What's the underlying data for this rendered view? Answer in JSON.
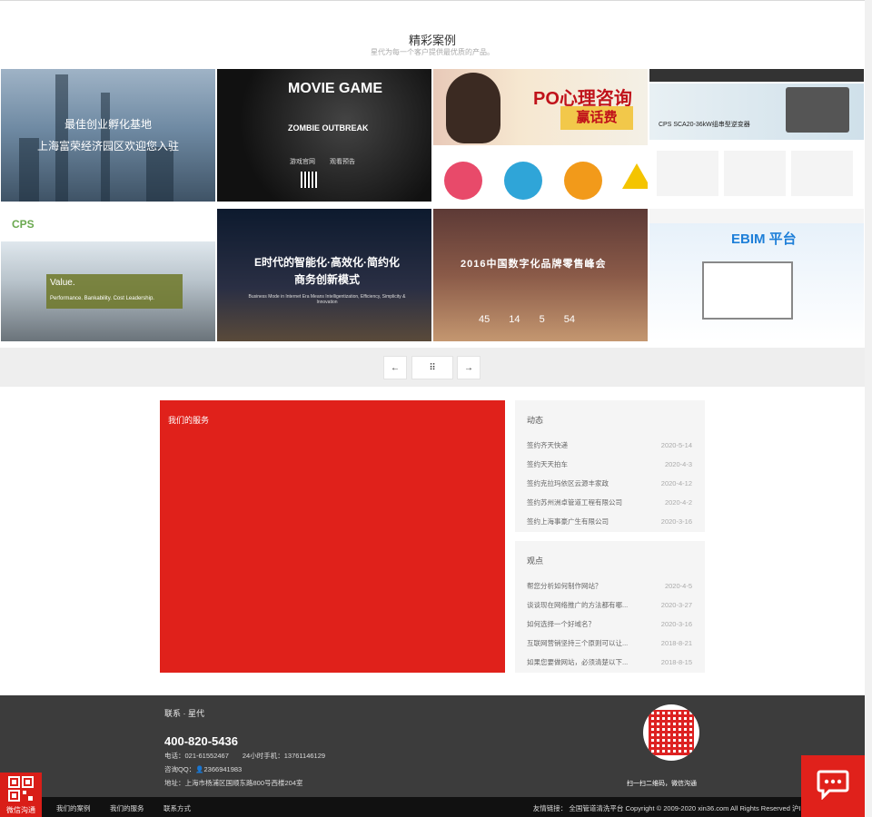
{
  "cases": {
    "title": "精彩案例",
    "subtitle": "星代为每一个客户提供最优质的产品。",
    "tiles": [
      {
        "line1": "最佳创业孵化基地",
        "line2": "上海富荣经济园区欢迎您入驻"
      },
      {
        "line1": "MOVIE GAME",
        "line2": "ZOMBIE OUTBREAK",
        "link1": "游戏官网",
        "link2": "观看预告"
      },
      {
        "line1": "PO心理咨询",
        "line2": "赢话费"
      },
      {
        "line1": "CPS SCA20-36kW组串型逆变器"
      },
      {
        "line1": "CPS",
        "line2": "Value.",
        "line3": "Performance. Bankability. Cost Leadership."
      },
      {
        "line1": "E时代的智能化·高效化·简约化",
        "line2": "商务创新模式",
        "line3": "Business Mode in Internet Era Means Intelligentization, Efficiency, Simplicity & Innovation"
      },
      {
        "line1": "2016中国数字化品牌零售峰会",
        "line2": "45    14    5    54"
      },
      {
        "line1": "EBIM 平台"
      }
    ],
    "prev": "←",
    "dots": "⠿",
    "next": "→"
  },
  "service": {
    "label": "我们的服务"
  },
  "news": {
    "heading": "动态",
    "items": [
      {
        "title": "签约齐天快递",
        "date": "2020-5-14"
      },
      {
        "title": "签约天天拍车",
        "date": "2020-4-3"
      },
      {
        "title": "签约克拉玛依区云源丰家政",
        "date": "2020-4-12"
      },
      {
        "title": "签约苏州洲卓管道工程有限公司",
        "date": "2020-4-2"
      },
      {
        "title": "签约上海事豪广生有限公司",
        "date": "2020-3-16"
      }
    ]
  },
  "views": {
    "heading": "观点",
    "items": [
      {
        "title": "帮您分析如何制作网站？",
        "date": "2020-4-5"
      },
      {
        "title": "谈谈现在网络推广的方法都有哪...",
        "date": "2020-3-27"
      },
      {
        "title": "如何选择一个好域名？",
        "date": "2020-3-16"
      },
      {
        "title": "互联网营销坚持三个原则可以让...",
        "date": "2018-8-21"
      },
      {
        "title": "如果您要做网站，必须清楚以下...",
        "date": "2018-8-15"
      }
    ]
  },
  "footer": {
    "heading": "联系 · 星代",
    "phone": "400-820-5436",
    "line_tel": "电话：021-61552467　　24小时手机：13761146129",
    "line_qq": "咨询QQ：👤2366941983",
    "line_addr": "地址：上海市杨浦区国顺东路800号西楼204室",
    "qr_caption": "扫一扫二维码，微信沟通"
  },
  "bottom": {
    "links": [
      "我们的案例",
      "我们的服务",
      "联系方式"
    ],
    "right": "友情链接：  全国管道清洗平台   Copyright © 2009-2020 xin36.com All Rights Reserved 沪ICP"
  },
  "wechat": {
    "label": "微信沟通"
  }
}
